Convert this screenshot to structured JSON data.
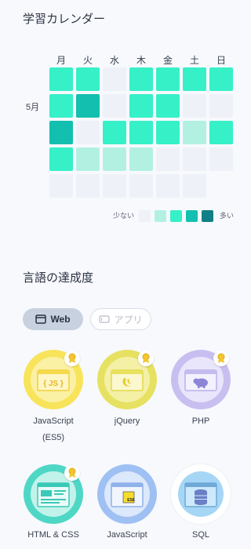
{
  "calendar": {
    "title": "学習カレンダー",
    "weekdays": [
      "月",
      "火",
      "水",
      "木",
      "金",
      "土",
      "日"
    ],
    "month_label": "5月",
    "grid": [
      [
        2,
        2,
        0,
        2,
        2,
        2,
        2
      ],
      [
        2,
        3,
        0,
        2,
        2,
        0,
        0
      ],
      [
        3,
        0,
        2,
        2,
        2,
        1,
        2
      ],
      [
        2,
        1,
        1,
        1,
        0,
        0,
        0
      ],
      [
        0,
        0,
        0,
        0,
        0,
        0,
        null
      ]
    ],
    "legend_less": "少ない",
    "legend_more": "多い",
    "level_colors": [
      "#eef1f8",
      "#b2f1e2",
      "#36f0c8",
      "#13bfae",
      "#117f85"
    ]
  },
  "achievement": {
    "title": "言語の達成度",
    "tabs": [
      {
        "label": "Web",
        "icon": "browser-icon",
        "active": true
      },
      {
        "label": "アプリ",
        "icon": "phone-icon",
        "active": false
      }
    ],
    "languages": [
      {
        "name": "JavaScript",
        "name2": "(ES5)",
        "icon": "js-icon",
        "ring": "#f8e45a",
        "medal": true
      },
      {
        "name": "jQuery",
        "name2": "",
        "icon": "jquery-icon",
        "ring": "#e6e160",
        "medal": true
      },
      {
        "name": "PHP",
        "name2": "",
        "icon": "php-elephant-icon",
        "ring": "#c8bff0",
        "medal": true
      },
      {
        "name": "HTML & CSS",
        "name2": "",
        "icon": "html-css-icon",
        "ring": "#4fd7c6",
        "medal": true
      },
      {
        "name": "JavaScript",
        "name2": "",
        "icon": "es6-icon",
        "ring": "#9fc0f2",
        "medal": false
      },
      {
        "name": "SQL",
        "name2": "",
        "icon": "database-icon",
        "ring": "#ffffff",
        "medal": false
      }
    ]
  }
}
